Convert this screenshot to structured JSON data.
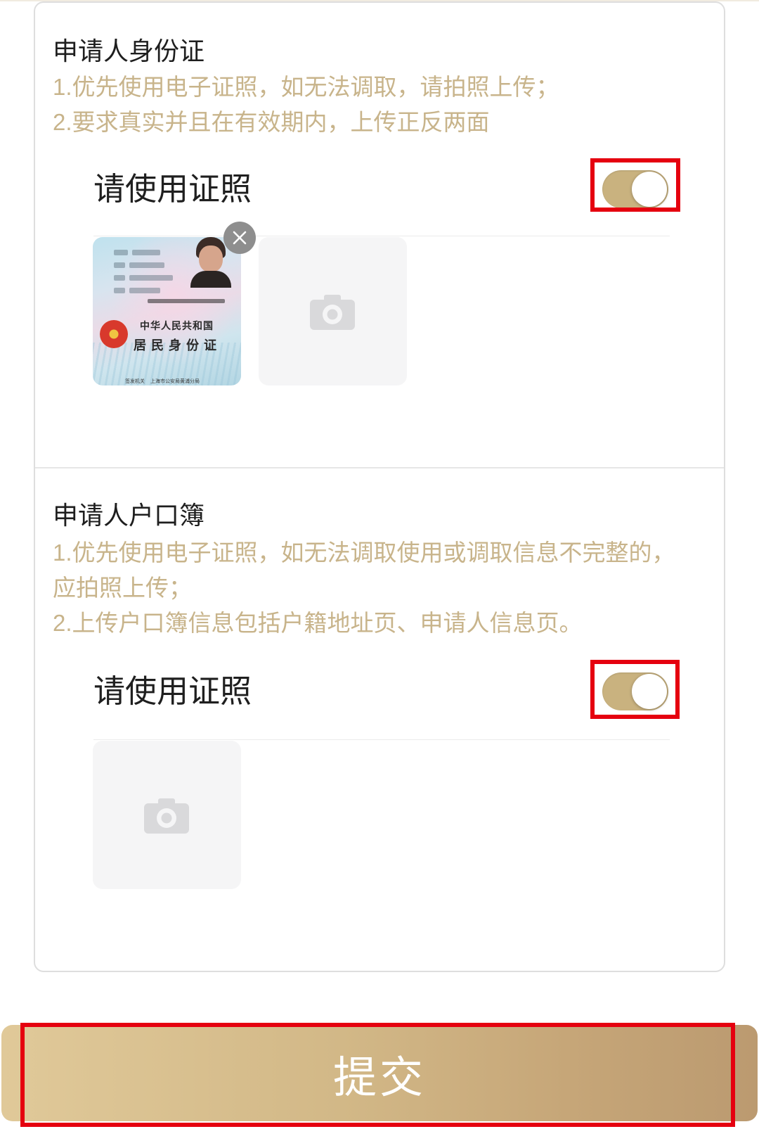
{
  "sections": [
    {
      "title": "申请人身份证",
      "hint_lines": [
        "1.优先使用电子证照，如无法调取，请拍照上传；",
        "2.要求真实并且在有效期内，上传正反两面"
      ],
      "toggle_label": "请使用证照",
      "toggle_on": true
    },
    {
      "title": "申请人户口簿",
      "hint_lines": [
        "1.优先使用电子证照，如无法调取使用或调取信息不完整的，",
        "应拍照上传；",
        "2.上传户口簿信息包括户籍地址页、申请人信息页。"
      ],
      "toggle_label": "请使用证照",
      "toggle_on": true
    }
  ],
  "id_card_thumbnail": {
    "country": "中华人民共和国",
    "document": "居民身份证",
    "authority_label": "签发机关",
    "authority": "上海市公安局黄浦分局"
  },
  "submit": {
    "label": "提交"
  },
  "icons": {
    "remove_photo": "close-icon",
    "upload_photo": "camera-icon",
    "card_emblem": "national-emblem-icon"
  },
  "colors": {
    "accent_gold": "#c9b27f",
    "hint_text": "#c8b48b",
    "highlight_red": "#e5000f",
    "submit_gradient_start": "#e0c999",
    "submit_gradient_end": "#bb9a70"
  }
}
